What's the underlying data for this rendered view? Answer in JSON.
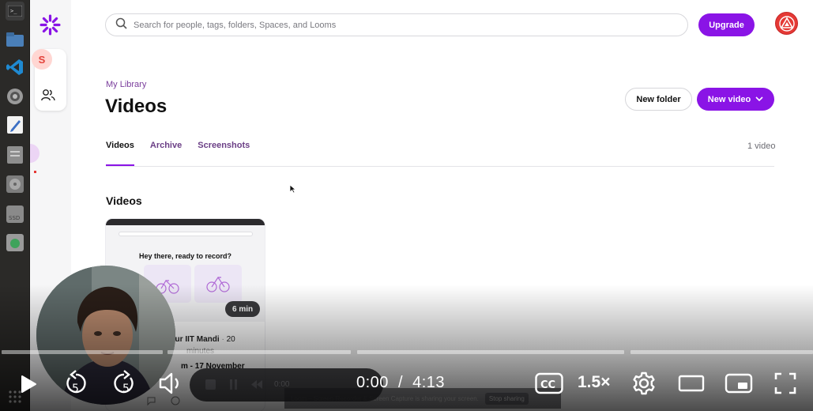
{
  "search": {
    "placeholder": "Search for people, tags, folders, Spaces, and Looms"
  },
  "header": {
    "upgrade_label": "Upgrade"
  },
  "sidebar": {
    "space_initial": "S"
  },
  "library": {
    "breadcrumb": "My Library",
    "title": "Videos",
    "new_folder_label": "New folder",
    "new_video_label": "New video",
    "tabs": [
      {
        "label": "Videos"
      },
      {
        "label": "Archive"
      },
      {
        "label": "Screenshots"
      }
    ],
    "video_count": "1 video",
    "section_title": "Videos"
  },
  "video_card": {
    "thumbnail_heading": "Hey there, ready to record?",
    "duration": "6 min",
    "owner_partial": "kur IIT Mandi",
    "age_partial": "20",
    "age_unit": "minutes",
    "title_partial": "m - 17 November"
  },
  "loom_recorder": {
    "elapsed": "0:00"
  },
  "share_banner": {
    "text": "Loom – Screen Recorder & Screen Capture is sharing your screen.",
    "stop_label": "Stop sharing"
  },
  "player": {
    "current_time": "0:00",
    "separator": "/",
    "duration": "4:13",
    "speed": "1.5×",
    "cc_label": "CC"
  },
  "colors": {
    "accent": "#8a14e6",
    "breadcrumb": "#7a3d9c",
    "tab_text": "#6b3f86"
  }
}
